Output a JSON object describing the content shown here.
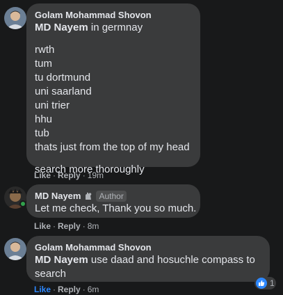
{
  "comments": [
    {
      "author": "Golam Mohammad Shovon",
      "mention": "MD Nayem",
      "first_line_rest": " in germnay",
      "list": [
        "rwth",
        "tum",
        "tu dortmund",
        "uni saarland",
        "uni trier",
        "hhu",
        "tub",
        "thats just from the top of my head"
      ],
      "closing": "search more thoroughly",
      "like_label": "Like",
      "reply_label": "Reply",
      "time": "19m"
    },
    {
      "author": "MD Nayem",
      "badge": "Author",
      "text": "Let me check, Thank you so much.",
      "like_label": "Like",
      "reply_label": "Reply",
      "time": "8m"
    },
    {
      "author": "Golam Mohammad Shovon",
      "mention": "MD Nayem",
      "line1_rest": " use daad and hosuchle compass to",
      "line2": "search",
      "like_label": "Like",
      "reply_label": "Reply",
      "time": "6m",
      "reaction_count": "1"
    }
  ],
  "separator": "·",
  "colors": {
    "background": "#18191a",
    "bubble": "#3a3b3c",
    "text": "#e4e6eb",
    "secondary": "#b0b3b8",
    "like_blue": "#2d88ff",
    "online_green": "#31a24c"
  }
}
